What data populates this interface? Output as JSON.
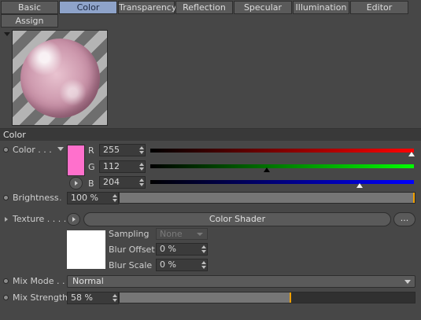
{
  "tabs": [
    {
      "label": "Basic",
      "active": false
    },
    {
      "label": "Color",
      "active": true
    },
    {
      "label": "Transparency",
      "active": false
    },
    {
      "label": "Reflection",
      "active": false
    },
    {
      "label": "Specular",
      "active": false
    },
    {
      "label": "Illumination",
      "active": false
    },
    {
      "label": "Editor",
      "active": false
    },
    {
      "label": "Assign",
      "active": false
    }
  ],
  "section": {
    "title": "Color"
  },
  "color": {
    "label": "Color . . .",
    "swatch_hex": "#ff70cc",
    "channels": [
      {
        "name": "R",
        "value": "255",
        "fraction": 1.0,
        "from": "#000000",
        "to": "#ff0000",
        "knob": "white"
      },
      {
        "name": "G",
        "value": "112",
        "fraction": 0.44,
        "from": "#000000",
        "to": "#00ff00",
        "knob": "black"
      },
      {
        "name": "B",
        "value": "204",
        "fraction": 0.8,
        "from": "#000000",
        "to": "#0000ff",
        "knob": "white"
      }
    ]
  },
  "brightness": {
    "label": "Brightness",
    "value": "100 %",
    "fraction": 1.0
  },
  "texture": {
    "label": "Texture . . . . .",
    "shader_label": "Color Shader",
    "more_label": "...",
    "sampling_label": "Sampling",
    "sampling_value": "None",
    "blur_offset_label": "Blur Offset",
    "blur_offset_value": "0 %",
    "blur_scale_label": "Blur Scale",
    "blur_scale_value": "0 %"
  },
  "mix_mode": {
    "label": "Mix Mode . .",
    "value": "Normal"
  },
  "mix_strength": {
    "label": "Mix Strength",
    "value": "58 %",
    "fraction": 0.58
  },
  "colors": {
    "accent": "#f0a000",
    "tab_active": "#8ea3c9"
  }
}
